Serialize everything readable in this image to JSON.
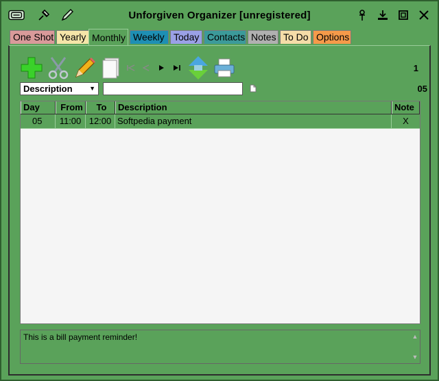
{
  "window": {
    "title": "Unforgiven Organizer [unregistered]"
  },
  "titlebar_icons": {
    "left": [
      "tray-icon",
      "pin-icon",
      "pen-icon"
    ],
    "right": [
      "push-pin-icon",
      "download-icon",
      "maximize-icon",
      "close-icon"
    ]
  },
  "tabs": [
    {
      "label": "One Shot",
      "color": "#d99a9a"
    },
    {
      "label": "Yearly",
      "color": "#f5e5a8"
    },
    {
      "label": "Monthly",
      "color": "#5aa25a",
      "active": true
    },
    {
      "label": "Weekly",
      "color": "#1e8fb4"
    },
    {
      "label": "Today",
      "color": "#9aa0e6"
    },
    {
      "label": "Contacts",
      "color": "#3c9a9a"
    },
    {
      "label": "Notes",
      "color": "#b0b0b0"
    },
    {
      "label": "To Do",
      "color": "#f5dca8"
    },
    {
      "label": "Options",
      "color": "#f59a4a"
    }
  ],
  "toolbar": {
    "icons": [
      "add-icon",
      "cut-icon",
      "edit-pencil-icon",
      "blank-page-icon",
      "first-icon",
      "previous-icon",
      "next-icon",
      "last-icon",
      "sort-icon",
      "print-icon"
    ],
    "page_number": "1"
  },
  "filter": {
    "field_selected": "Description",
    "search_value": "",
    "count": "05"
  },
  "table": {
    "columns": [
      "Day",
      "From",
      "To",
      "Description",
      "Note"
    ],
    "rows": [
      {
        "day": "05",
        "from": "11:00",
        "to": "12:00",
        "description": "Softpedia payment",
        "note": "X"
      }
    ]
  },
  "memo": {
    "text": "This is a bill payment reminder!"
  }
}
